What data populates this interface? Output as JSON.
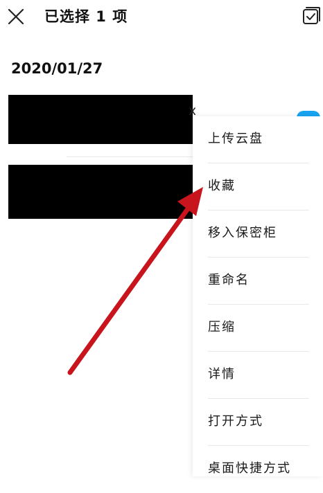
{
  "header": {
    "title": "已选择 1 项",
    "close_icon": "close-icon",
    "select_all_icon": "checkbox-select-all-icon"
  },
  "date_group": {
    "label": "2020/01/27"
  },
  "file_list": {
    "ext_fragment": "x",
    "rows": [
      {
        "state": "redacted"
      },
      {
        "state": "redacted"
      }
    ]
  },
  "context_menu": {
    "items": [
      {
        "label": "上传云盘"
      },
      {
        "label": "收藏"
      },
      {
        "label": "移入保密柜"
      },
      {
        "label": "重命名"
      },
      {
        "label": "压缩"
      },
      {
        "label": "详情"
      },
      {
        "label": "打开方式"
      },
      {
        "label": "桌面快捷方式"
      }
    ]
  },
  "annotation": {
    "arrow_color": "#c8141c",
    "points_to": "收藏"
  },
  "colors": {
    "accent": "#19a3f0",
    "redaction": "#000000",
    "divider": "#e8e8e8"
  }
}
